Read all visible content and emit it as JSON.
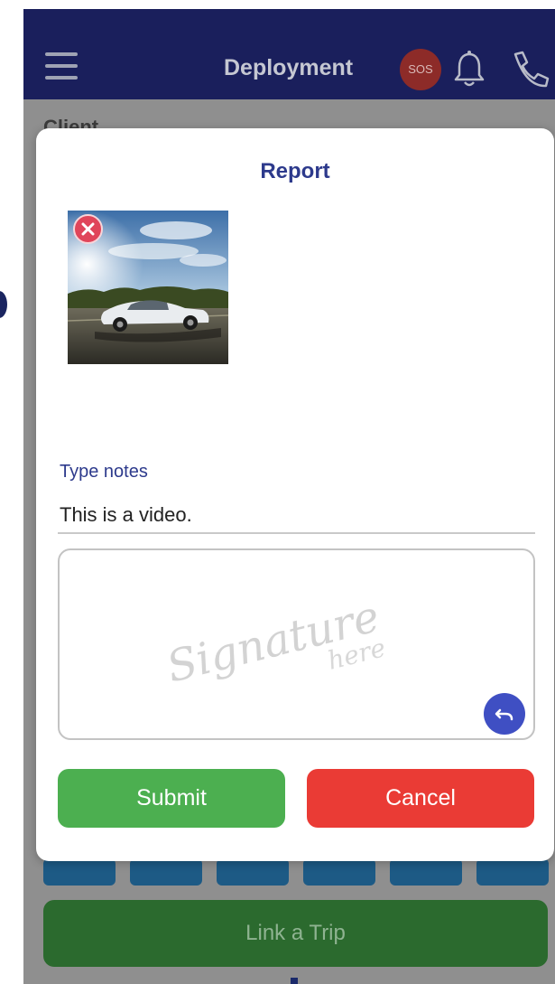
{
  "appbar": {
    "title": "Deployment",
    "sos_label": "SOS",
    "menu_icon": "hamburger-menu-icon",
    "bell_icon": "bell-icon",
    "phone_icon": "phone-icon"
  },
  "background": {
    "client_label": "Client",
    "link_trip_label": "Link a Trip"
  },
  "dialog": {
    "title": "Report",
    "attachment": {
      "kind": "image",
      "description_icon": "photo-thumbnail",
      "remove_icon": "close-circle-icon"
    },
    "notes_label": "Type notes",
    "notes_value": "This is a video.",
    "signature_placeholder": [
      "Signature",
      "here"
    ],
    "undo_icon": "undo-icon",
    "submit_label": "Submit",
    "cancel_label": "Cancel"
  },
  "colors": {
    "appbar": "#1a1f5c",
    "accent": "#2d3a8c",
    "submit": "#4caf50",
    "cancel": "#ea3b35",
    "undo": "#3f4fc3",
    "remove": "#e0455a"
  }
}
